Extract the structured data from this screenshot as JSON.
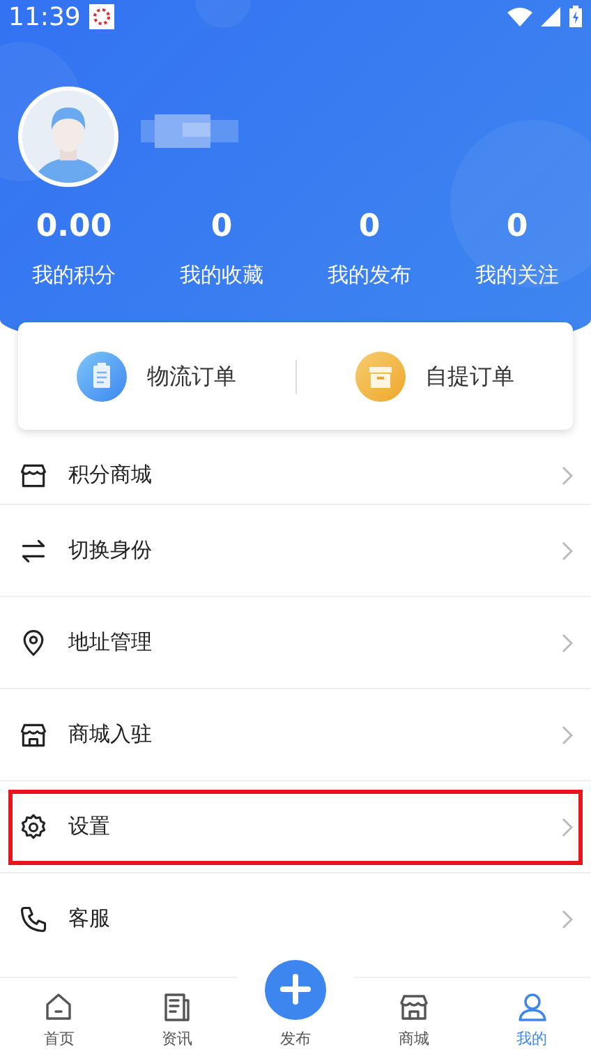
{
  "status_bar": {
    "time": "11:39"
  },
  "stats": [
    {
      "value": "0.00",
      "label": "我的积分"
    },
    {
      "value": "0",
      "label": "我的收藏"
    },
    {
      "value": "0",
      "label": "我的发布"
    },
    {
      "value": "0",
      "label": "我的关注"
    }
  ],
  "orders": [
    {
      "kind": "logistics",
      "label": "物流订单"
    },
    {
      "kind": "pickup",
      "label": "自提订单"
    }
  ],
  "menu": [
    {
      "kind": "shop",
      "label": "积分商城",
      "highlighted": false
    },
    {
      "kind": "switch",
      "label": "切换身份",
      "highlighted": false
    },
    {
      "kind": "pin",
      "label": "地址管理",
      "highlighted": false
    },
    {
      "kind": "store",
      "label": "商城入驻",
      "highlighted": false
    },
    {
      "kind": "gear",
      "label": "设置",
      "highlighted": true
    },
    {
      "kind": "phone",
      "label": "客服",
      "highlighted": false
    }
  ],
  "tabs": [
    {
      "kind": "home",
      "label": "首页",
      "selected": false
    },
    {
      "kind": "news",
      "label": "资讯",
      "selected": false
    },
    {
      "kind": "plus",
      "label": "发布",
      "selected": false
    },
    {
      "kind": "store",
      "label": "商城",
      "selected": false
    },
    {
      "kind": "user",
      "label": "我的",
      "selected": true
    }
  ]
}
